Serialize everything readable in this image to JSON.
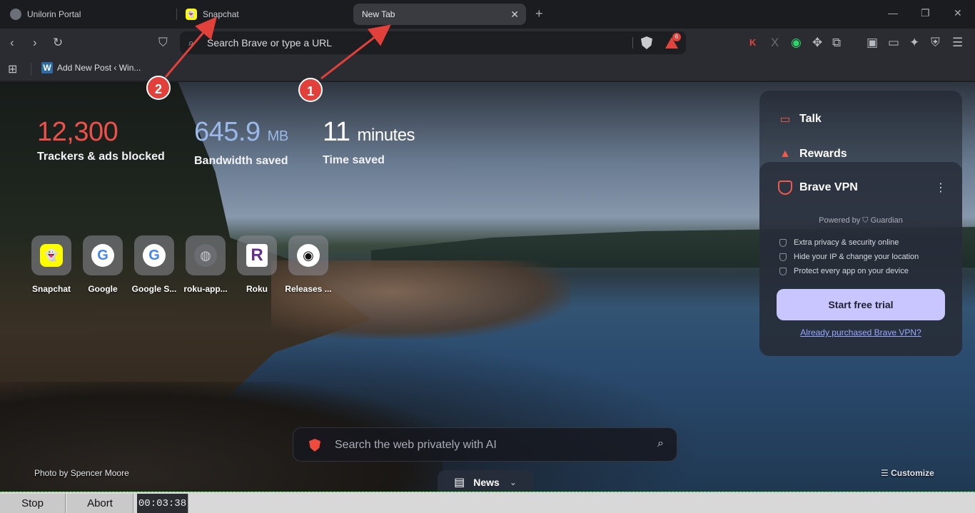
{
  "tabs": [
    {
      "label": "Unilorin Portal",
      "icon": "globe-icon"
    },
    {
      "label": "Snapchat",
      "icon": "snapchat-icon"
    },
    {
      "label": "New Tab",
      "icon": "",
      "active": true
    }
  ],
  "toolbar": {
    "url_placeholder": "Search Brave or type a URL",
    "rewards_badge": "6"
  },
  "bookmarks": [
    {
      "label": "Add New Post ‹ Win...",
      "icon": "W"
    }
  ],
  "stats": {
    "trackers": {
      "value": "12,300",
      "unit": "",
      "label": "Trackers & ads blocked"
    },
    "bandwidth": {
      "value": "645.9",
      "unit": "MB",
      "label": "Bandwidth saved"
    },
    "time": {
      "value": "11",
      "unit": "minutes",
      "label": "Time saved"
    }
  },
  "top_sites": [
    {
      "label": "Snapchat",
      "glyph": "👻"
    },
    {
      "label": "Google",
      "glyph": "G"
    },
    {
      "label": "Google S...",
      "glyph": "G"
    },
    {
      "label": "roku-app...",
      "glyph": "◍"
    },
    {
      "label": "Roku",
      "glyph": "R"
    },
    {
      "label": "Releases ...",
      "glyph": "◉"
    }
  ],
  "widgets": {
    "talk": "Talk",
    "rewards": "Rewards",
    "vpn": {
      "title": "Brave VPN",
      "powered_by": "Powered by ⛉ Guardian",
      "features": [
        "Extra privacy & security online",
        "Hide your IP & change your location",
        "Protect every app on your device"
      ],
      "cta": "Start free trial",
      "link": "Already purchased Brave VPN?"
    }
  },
  "search": {
    "placeholder": "Search the web privately with AI"
  },
  "footer": {
    "credit": "Photo by Spencer Moore",
    "customize": "Customize",
    "news": "News"
  },
  "annotations": [
    "1",
    "2"
  ],
  "recorder": {
    "stop": "Stop",
    "abort": "Abort",
    "time": "00:03:38"
  },
  "colors": {
    "accent": "#e2403a",
    "trackers": "#f0504a",
    "bandwidth": "#9ab8e8",
    "vpn_cta": "#c9c6ff"
  }
}
